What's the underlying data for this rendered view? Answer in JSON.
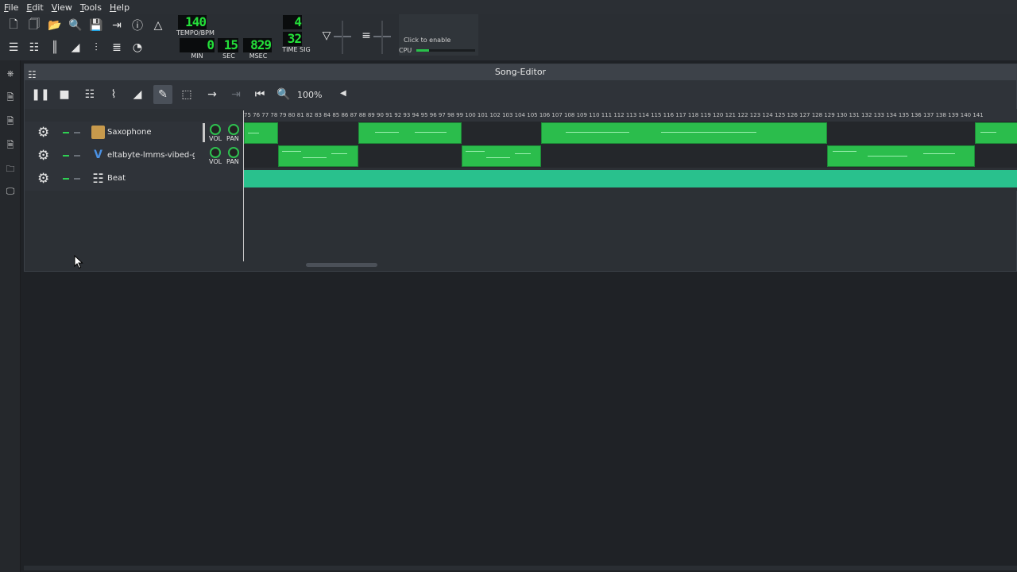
{
  "menu": [
    "File",
    "Edit",
    "View",
    "Tools",
    "Help"
  ],
  "display": {
    "tempo": "140",
    "tempo_label": "TEMPO/BPM",
    "min": "0",
    "sec": "15",
    "msec": "829",
    "min_label": "MIN",
    "sec_label": "SEC",
    "msec_label": "MSEC",
    "timesig_num": "4",
    "timesig_den": "32",
    "timesig_label": "TIME SIG"
  },
  "cpu": {
    "enable_text": "Click to enable",
    "label": "CPU",
    "level_fraction": 0.22
  },
  "song_editor": {
    "title": "Song-Editor",
    "zoom": "100%",
    "ruler_text": "75 76 77 78 79 80 81 82 83 84 85 86 87 88 89 90 91 92 93 94 95 96 97 98 99 100 101 102 103 104 105 106 107 108 109 110 111 112 113 114 115 116 117 118 119 120 121 122 123 124 125 126 127 128 129 130 131 132 133 134 135 136 137 138 139 140 141"
  },
  "tracks": [
    {
      "name": "Saxophone",
      "vol_label": "VOL",
      "pan_label": "PAN",
      "icon": "saxophone-icon"
    },
    {
      "name": "eltabyte-lmms-vibed-g...",
      "vol_label": "VOL",
      "pan_label": "PAN",
      "icon": "vibed-icon"
    },
    {
      "name": "Beat",
      "icon": "beat-grid-icon"
    }
  ],
  "colors": {
    "clip_green": "#2bbd4c",
    "beat_teal": "#29c18d",
    "lcd_green": "#24e03a"
  }
}
